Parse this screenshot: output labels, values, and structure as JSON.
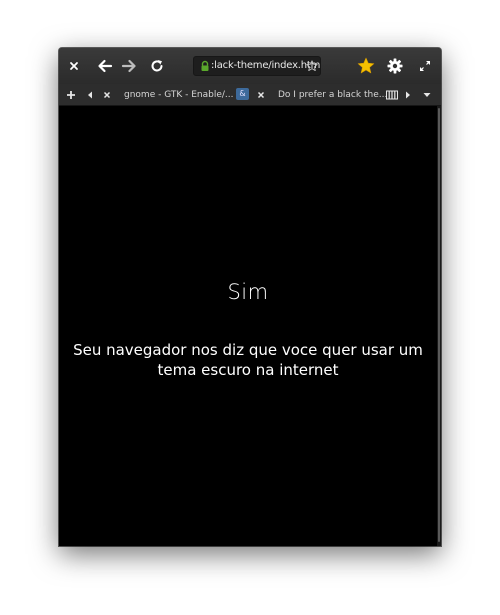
{
  "browser": {
    "url": "black-theme/index.html",
    "url_display": ":lack-theme/index.html",
    "tabs": [
      {
        "label": "gnome - GTK - Enable/..."
      },
      {
        "label": "Do I prefer a black the..."
      }
    ],
    "tab1_badge": "&"
  },
  "page": {
    "heading": "Sim",
    "message": "Seu navegador nos diz que voce quer usar um tema escuro na internet"
  },
  "icons": {
    "close": "close-icon",
    "back": "arrow-left-icon",
    "forward": "arrow-right-icon",
    "reload": "reload-icon",
    "lock": "lock-icon",
    "bookmark_star": "star-outline-icon",
    "bookmarks": "star-icon",
    "settings": "gear-icon",
    "expand": "expand-icon"
  },
  "colors": {
    "page_background": "#000000",
    "text": "#ffffff",
    "bookmark_star": "#f5c000",
    "lock": "#5aa82c"
  }
}
